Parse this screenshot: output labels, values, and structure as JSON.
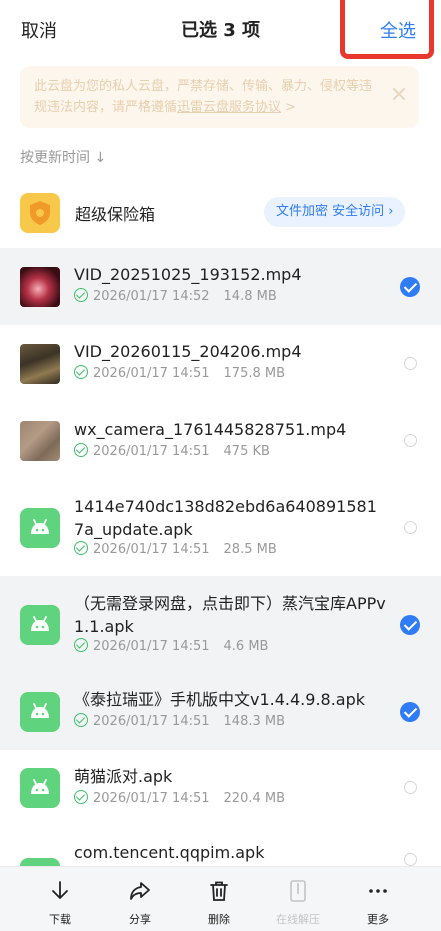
{
  "header": {
    "cancel_label": "取消",
    "title": "已选 3 项",
    "select_all_label": "全选"
  },
  "notice": {
    "text": "此云盘为您的私人云盘，严禁存储、传输、暴力、侵权等违规违法内容，请严格遵循",
    "link_text": "迅雷云盘服务协议",
    "link_suffix": " >"
  },
  "sort_label": "按更新时间 ↓",
  "vault": {
    "label": "超级保险箱",
    "action_label": "文件加密 安全访问 ›"
  },
  "files": [
    {
      "name": "VID_20251025_193152.mp4",
      "date": "2026/01/17 14:52",
      "size": "14.8 MB",
      "selected": true,
      "thumb": "video-red"
    },
    {
      "name": "VID_20260115_204206.mp4",
      "date": "2026/01/17 14:51",
      "size": "175.8 MB",
      "selected": false,
      "thumb": "video-room"
    },
    {
      "name": "wx_camera_1761445828751.mp4",
      "date": "2026/01/17 14:51",
      "size": "475 KB",
      "selected": false,
      "thumb": "video-ground"
    },
    {
      "name": "1414e740dc138d82ebd6a6408915817a_update.apk",
      "date": "2026/01/17 14:51",
      "size": "28.5 MB",
      "selected": false,
      "thumb": "apk"
    },
    {
      "name": "（无需登录网盘，点击即下）蒸汽宝库APPv1.1.apk",
      "date": "2026/01/17 14:51",
      "size": "4.6 MB",
      "selected": true,
      "thumb": "apk"
    },
    {
      "name": "《泰拉瑞亚》手机版中文v1.4.4.9.8.apk",
      "date": "2026/01/17 14:51",
      "size": "148.3 MB",
      "selected": true,
      "thumb": "apk"
    },
    {
      "name": "萌猫派对.apk",
      "date": "2026/01/17 14:51",
      "size": "220.4 MB",
      "selected": false,
      "thumb": "apk"
    },
    {
      "name": "com.tencent.qqpim.apk",
      "date": "",
      "size": "",
      "selected": false,
      "thumb": "apk"
    }
  ],
  "toolbar": {
    "download_label": "下载",
    "share_label": "分享",
    "delete_label": "删除",
    "unzip_label": "在线解压",
    "more_label": "更多"
  },
  "colors": {
    "accent": "#2f7cf6",
    "selected_row": "#f2f3f5",
    "highlight": "#e8372c",
    "apk_icon": "#5fd37d",
    "vault_icon": "#f7c84a"
  }
}
